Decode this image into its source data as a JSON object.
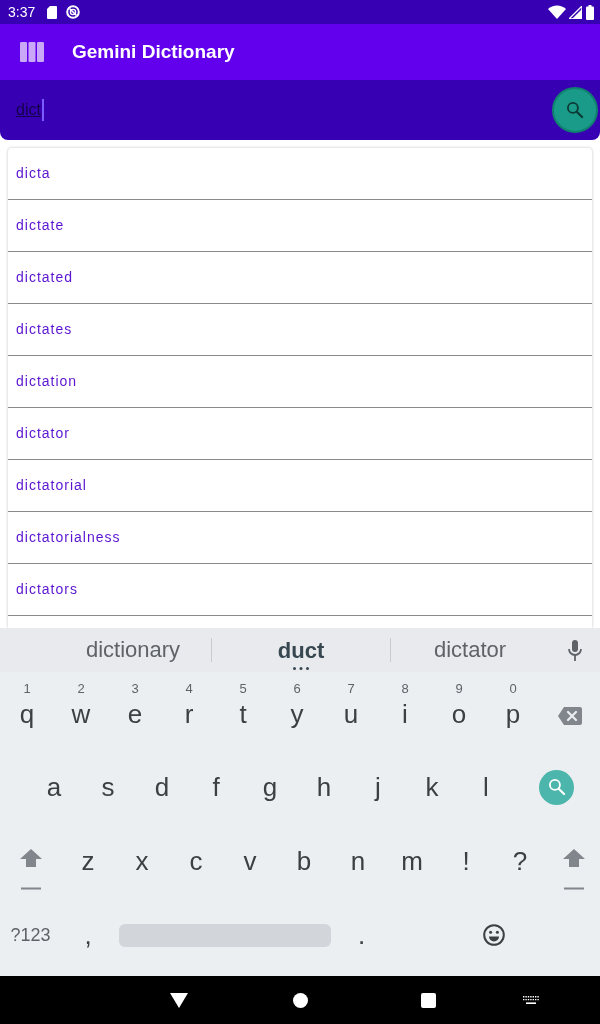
{
  "status_bar": {
    "time": "3:37"
  },
  "app_bar": {
    "title": "Gemini Dictionary"
  },
  "search": {
    "value": "dict"
  },
  "results": [
    "dicta",
    "dictate",
    "dictated",
    "dictates",
    "dictation",
    "dictator",
    "dictatorial",
    "dictatorialness",
    "dictators"
  ],
  "keyboard": {
    "suggestions": [
      {
        "text": "dictionary",
        "selected": false
      },
      {
        "text": "duct",
        "selected": true
      },
      {
        "text": "dictator",
        "selected": false
      }
    ],
    "rows": [
      [
        {
          "kind": "char",
          "label": "q",
          "hint": "1"
        },
        {
          "kind": "char",
          "label": "w",
          "hint": "2"
        },
        {
          "kind": "char",
          "label": "e",
          "hint": "3"
        },
        {
          "kind": "char",
          "label": "r",
          "hint": "4"
        },
        {
          "kind": "char",
          "label": "t",
          "hint": "5"
        },
        {
          "kind": "char",
          "label": "y",
          "hint": "6"
        },
        {
          "kind": "char",
          "label": "u",
          "hint": "7"
        },
        {
          "kind": "char",
          "label": "i",
          "hint": "8"
        },
        {
          "kind": "char",
          "label": "o",
          "hint": "9"
        },
        {
          "kind": "char",
          "label": "p",
          "hint": "0"
        },
        {
          "kind": "backspace"
        }
      ],
      [
        {
          "kind": "char",
          "label": "a"
        },
        {
          "kind": "char",
          "label": "s"
        },
        {
          "kind": "char",
          "label": "d"
        },
        {
          "kind": "char",
          "label": "f"
        },
        {
          "kind": "char",
          "label": "g"
        },
        {
          "kind": "char",
          "label": "h"
        },
        {
          "kind": "char",
          "label": "j"
        },
        {
          "kind": "char",
          "label": "k"
        },
        {
          "kind": "char",
          "label": "l"
        },
        {
          "kind": "search"
        }
      ],
      [
        {
          "kind": "shift"
        },
        {
          "kind": "char",
          "label": "z"
        },
        {
          "kind": "char",
          "label": "x"
        },
        {
          "kind": "char",
          "label": "c"
        },
        {
          "kind": "char",
          "label": "v"
        },
        {
          "kind": "char",
          "label": "b"
        },
        {
          "kind": "char",
          "label": "n"
        },
        {
          "kind": "char",
          "label": "m"
        },
        {
          "kind": "char",
          "label": "!"
        },
        {
          "kind": "char",
          "label": "?"
        },
        {
          "kind": "shift"
        }
      ],
      [
        {
          "kind": "symbols",
          "label": "?123"
        },
        {
          "kind": "char",
          "label": ","
        },
        {
          "kind": "space"
        },
        {
          "kind": "char",
          "label": "."
        },
        {
          "kind": "emoji"
        }
      ]
    ]
  }
}
